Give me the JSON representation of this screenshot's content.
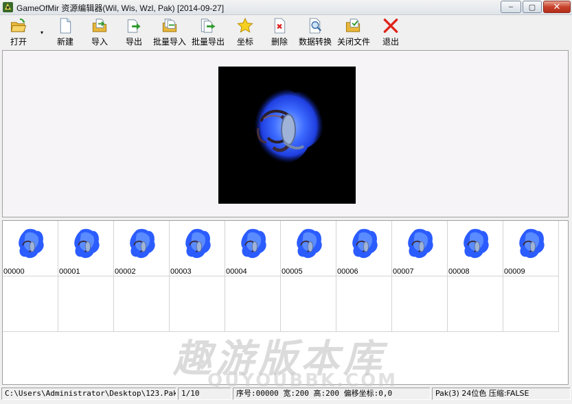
{
  "window": {
    "title": "GameOfMir 资源编辑器(Wil, Wis, Wzl, Pak) [2014-09-27]",
    "minimize_label": "–",
    "maximize_label": "▢",
    "close_label": "✕"
  },
  "toolbar": {
    "open": "打开",
    "new": "新建",
    "import": "导入",
    "export": "导出",
    "batch_import": "批量导入",
    "batch_export": "批量导出",
    "coordinates": "坐标",
    "delete": "删除",
    "data_convert": "数据转换",
    "close_file": "关闭文件",
    "exit": "退出",
    "dropdown_arrow": "▾"
  },
  "thumbnails": [
    {
      "label": "00000"
    },
    {
      "label": "00001"
    },
    {
      "label": "00002"
    },
    {
      "label": "00003"
    },
    {
      "label": "00004"
    },
    {
      "label": "00005"
    },
    {
      "label": "00006"
    },
    {
      "label": "00007"
    },
    {
      "label": "00008"
    },
    {
      "label": "00009"
    }
  ],
  "status": {
    "path": "C:\\Users\\Administrator\\Desktop\\123.Pak",
    "page": "1/10",
    "info": "序号:00000 宽:200 高:200 偏移坐标:0,0",
    "format": "Pak(3) 24位色 压缩:FALSE"
  },
  "watermark": {
    "text_cn": "趣游版本库",
    "text_en": "QUYOUBBK.COM"
  },
  "colors": {
    "sprite_blue": "#2b5cff",
    "sprite_glow": "#6fa0ff",
    "preview_bg": "#000000",
    "close_red": "#c8432d"
  },
  "icons": {
    "app": "app-icon",
    "open": "folder-open-icon",
    "new": "new-file-icon",
    "import": "import-folder-icon",
    "export": "export-arrow-icon",
    "batch_import": "batch-import-icon",
    "batch_export": "batch-export-icon",
    "coordinates": "star-icon",
    "delete": "delete-file-icon",
    "data_convert": "magnifier-file-icon",
    "close_file": "close-folder-icon",
    "exit": "red-x-icon"
  }
}
